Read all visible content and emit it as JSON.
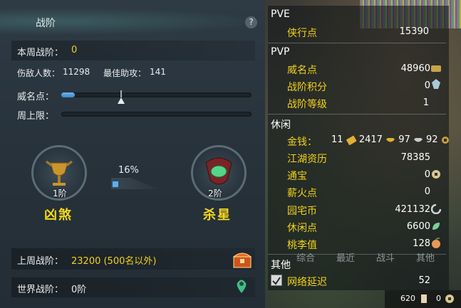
{
  "panel": {
    "title": "战阶",
    "help": "?",
    "weekly_rank_label": "本周战阶：",
    "weekly_rank_value": "0",
    "kills_label": "伤敌人数：",
    "kills_value": "11298",
    "best_assist_label": "最佳助攻：",
    "best_assist_value": "141",
    "prestige_label": "威名点：",
    "prestige_progress": 0.07,
    "weekly_cap_label": "周上限：",
    "weekly_cap_progress": 0,
    "current_rank": {
      "level": "1阶",
      "name": "凶煞"
    },
    "next_rank": {
      "level": "2阶",
      "name": "杀星"
    },
    "rank_progress_label": "16%",
    "rank_progress": 0.16,
    "last_week_label": "上周战阶：",
    "last_week_value": "23200 (500名以外)",
    "world_rank_label": "世界战阶：",
    "world_rank_value": "0阶"
  },
  "stats": {
    "pve_header": "PVE",
    "xiaxing_label": "侠行点",
    "xiaxing_value": "15390",
    "pvp_header": "PVP",
    "weiming_label": "威名点",
    "weiming_value": "48960",
    "zhanjie_score_label": "战阶积分",
    "zhanjie_score_value": "0",
    "zhanjie_level_label": "战阶等级",
    "zhanjie_level_value": "1",
    "leisure_header": "休闲",
    "money_label": "金钱：",
    "money_gold": "11",
    "money_silver_ingot": "2417",
    "money_silver": "97",
    "money_copper": "92",
    "jianghu_label": "江湖资历",
    "jianghu_value": "78385",
    "tongbao_label": "通宝",
    "tongbao_value": "0",
    "xinhuo_label": "薪火点",
    "xinhuo_value": "0",
    "yuanzhai_label": "园宅币",
    "yuanzhai_value": "421132",
    "xiuxian_label": "休闲点",
    "xiuxian_value": "6600",
    "taoli_label": "桃李值",
    "taoli_value": "128",
    "other_header": "其他",
    "latency_label": "网络延迟",
    "latency_value": "52"
  },
  "chat_tabs": [
    "综合",
    "最近",
    "战斗",
    "其他"
  ],
  "bottom_bar": {
    "value1": "620",
    "value2": "0"
  },
  "colors": {
    "accent_yellow": "#f2d21a",
    "bar_blue": "#4a9de0"
  }
}
